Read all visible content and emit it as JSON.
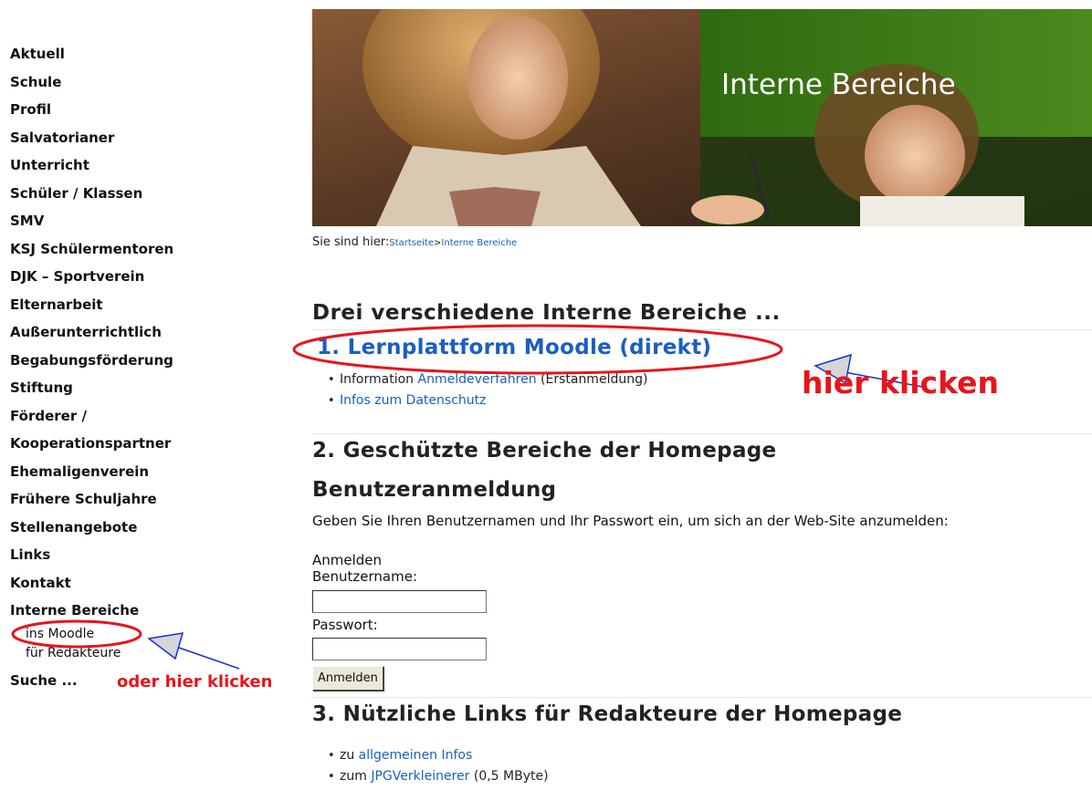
{
  "sidebar": {
    "items": [
      {
        "label": "Aktuell"
      },
      {
        "label": "Schule"
      },
      {
        "label": "Profil"
      },
      {
        "label": "Salvatorianer"
      },
      {
        "label": "Unterricht"
      },
      {
        "label": "Schüler / Klassen"
      },
      {
        "label": "SMV"
      },
      {
        "label": "KSJ Schülermentoren"
      },
      {
        "label": "DJK – Sportverein"
      },
      {
        "label": "Elternarbeit"
      },
      {
        "label": "Außerunterrichtlich"
      },
      {
        "label": "Begabungsförderung"
      },
      {
        "label": "Stiftung"
      },
      {
        "label": "Förderer /"
      },
      {
        "label": "Kooperationspartner"
      },
      {
        "label": "Ehemaligenverein"
      },
      {
        "label": "Frühere Schuljahre"
      },
      {
        "label": "Stellenangebote"
      },
      {
        "label": "Links"
      },
      {
        "label": "Kontakt"
      },
      {
        "label": "Interne Bereiche"
      }
    ],
    "subitems": [
      {
        "label": "ins Moodle"
      },
      {
        "label": "für Redakteure"
      }
    ],
    "last_item": "Suche ..."
  },
  "banner": {
    "title": "Interne Bereiche"
  },
  "breadcrumb": {
    "prefix": "Sie sind hier:",
    "home": "Startseite",
    "separator": ">",
    "current": "Interne Bereiche"
  },
  "main": {
    "page_title": "Drei verschiedene Interne Bereiche ...",
    "section1": {
      "heading": "1. Lernplattform Moodle (direkt)",
      "bullets": [
        {
          "prefix": "Information ",
          "link": "Anmeldeverfahren",
          "suffix": " (Erstanmeldung)"
        },
        {
          "prefix": "",
          "link": "Infos zum Datenschutz",
          "suffix": ""
        }
      ]
    },
    "section2": {
      "heading": "2. Geschützte Bereiche der Homepage",
      "login_heading": "Benutzeranmeldung",
      "intro": "Geben Sie Ihren Benutzernamen und Ihr Passwort ein, um sich an der Web-Site anzumelden:",
      "form_title": "Anmelden",
      "username_label": "Benutzername:",
      "username_value": "",
      "password_label": "Passwort:",
      "password_value": "",
      "submit_label": "Anmelden"
    },
    "section3": {
      "heading": "3. Nützliche Links für Redakteure der Homepage",
      "bullets": [
        {
          "prefix": "zu ",
          "link": "allgemeinen Infos",
          "suffix": ""
        },
        {
          "prefix": "zum ",
          "link": "JPGVerkleinerer",
          "suffix": " (0,5 MByte)"
        }
      ]
    }
  },
  "annotations": {
    "hier_klicken": "hier klicken",
    "oder_hier_klicken": "oder hier klicken",
    "color": "#e8141b",
    "arrow_color": "#1530d8"
  },
  "colors": {
    "link": "#1a5fc0",
    "banner_green": "#3f7a16"
  },
  "icons": {
    "bullet": "bullet-icon",
    "arrow": "arrow-icon"
  }
}
